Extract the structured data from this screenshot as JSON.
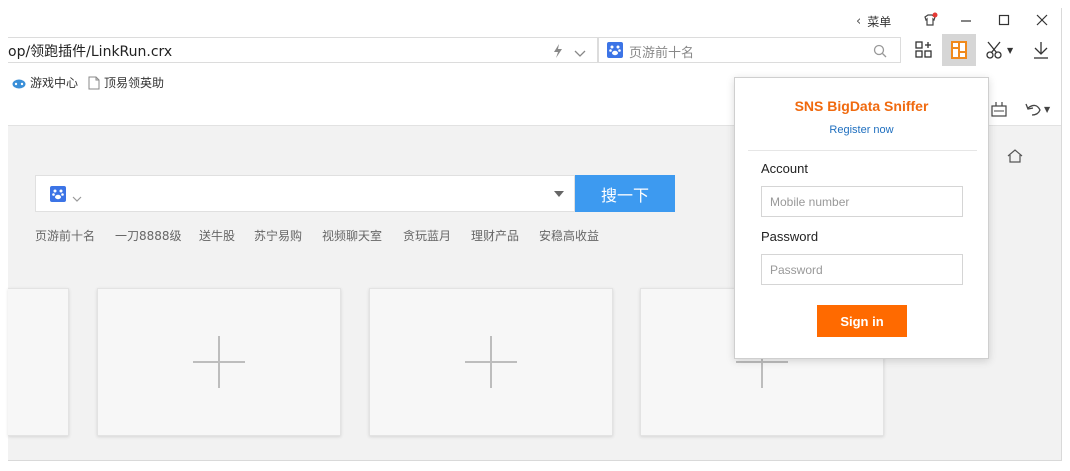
{
  "titlebar": {
    "menu_label": "菜单"
  },
  "address": {
    "url": "op/领跑插件/LinkRun.crx"
  },
  "search": {
    "placeholder": "页游前十名"
  },
  "bookmarks": [
    {
      "label": "游戏中心",
      "icon": "game-controller-icon"
    },
    {
      "label": "顶易领英助",
      "icon": "page-icon"
    }
  ],
  "page": {
    "search_button": "搜一下",
    "hot_links": [
      "页游前十名",
      "一刀8888级",
      "送牛股",
      "苏宁易购",
      "视频聊天室",
      "贪玩蓝月",
      "理财产品",
      "安稳高收益"
    ]
  },
  "popup": {
    "title": "SNS BigData Sniffer",
    "register": "Register now",
    "account_label": "Account",
    "account_placeholder": "Mobile number",
    "password_label": "Password",
    "password_placeholder": "Password",
    "signin": "Sign in"
  },
  "colors": {
    "accent_orange": "#ff6a00",
    "title_orange": "#f06a0f",
    "link_blue": "#1f6fbf",
    "search_blue": "#3d9af0"
  }
}
